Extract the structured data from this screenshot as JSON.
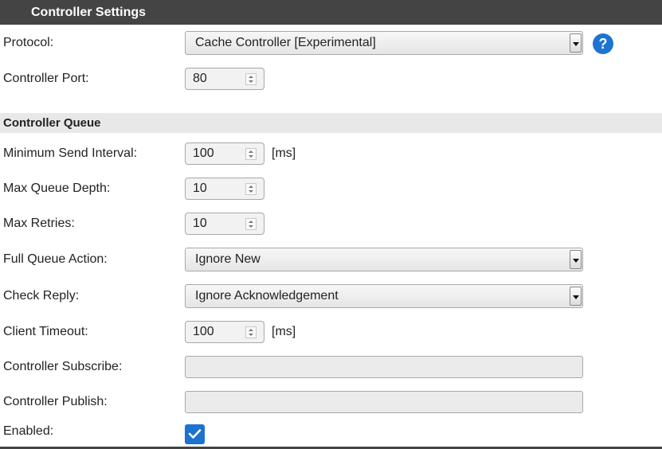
{
  "header": {
    "title": "Controller Settings"
  },
  "protocol": {
    "label": "Protocol:",
    "value": "Cache Controller [Experimental]",
    "help": "?"
  },
  "port": {
    "label": "Controller Port:",
    "value": "80"
  },
  "queue_section": {
    "title": "Controller Queue"
  },
  "min_interval": {
    "label": "Minimum Send Interval:",
    "value": "100",
    "unit": "[ms]"
  },
  "max_depth": {
    "label": "Max Queue Depth:",
    "value": "10"
  },
  "max_retries": {
    "label": "Max Retries:",
    "value": "10"
  },
  "full_queue": {
    "label": "Full Queue Action:",
    "value": "Ignore New"
  },
  "check_reply": {
    "label": "Check Reply:",
    "value": "Ignore Acknowledgement"
  },
  "client_timeout": {
    "label": "Client Timeout:",
    "value": "100",
    "unit": "[ms]"
  },
  "subscribe": {
    "label": "Controller Subscribe:",
    "value": ""
  },
  "publish": {
    "label": "Controller Publish:",
    "value": ""
  },
  "enabled": {
    "label": "Enabled:",
    "checked": true
  },
  "colors": {
    "header_bg": "#444444",
    "section_bg": "#e8e8e8",
    "accent": "#1e74d1"
  }
}
